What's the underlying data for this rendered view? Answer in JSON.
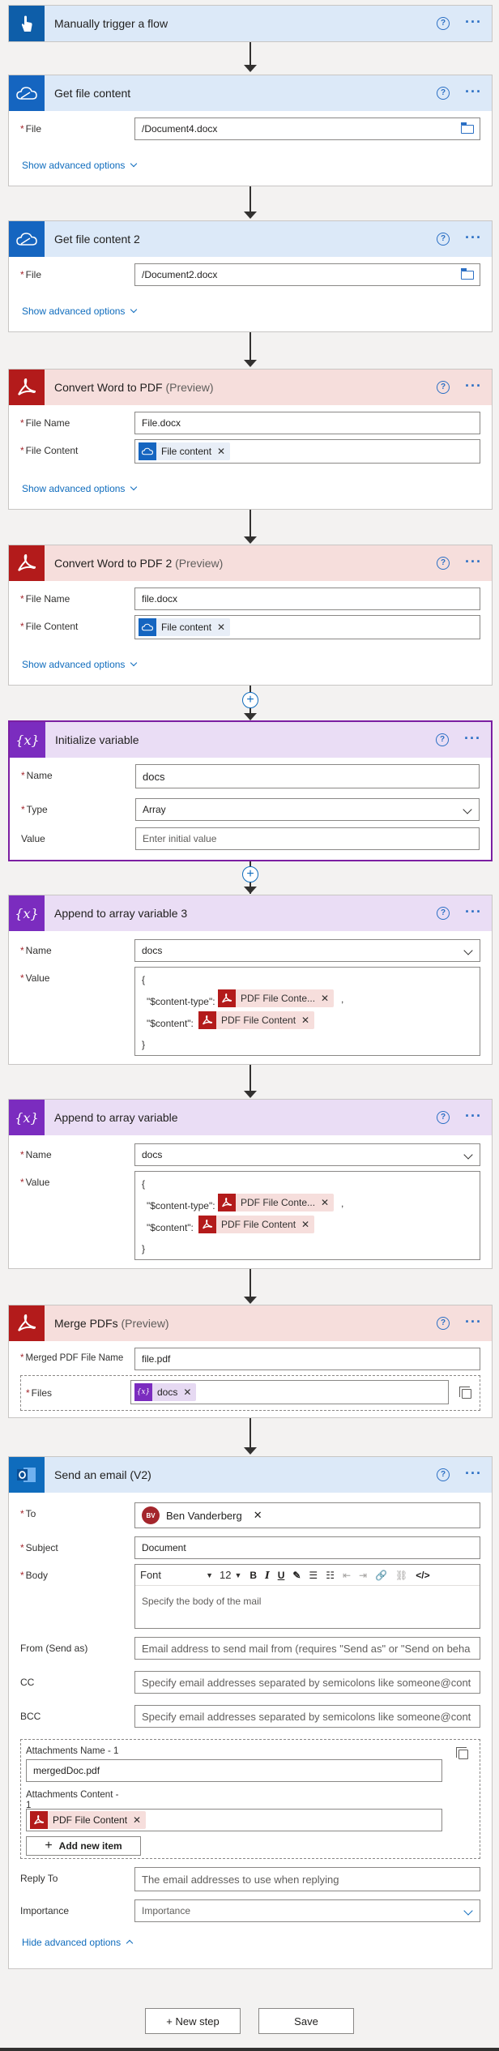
{
  "colors": {
    "blue_header": "#dce9f8",
    "red_header": "#f6dedc",
    "purple_header": "#eaddf5",
    "link": "#0f6cbd",
    "selected_border": "#7b1fa2"
  },
  "trigger": {
    "title": "Manually trigger a flow",
    "icon": "touch-icon"
  },
  "get_file_1": {
    "title": "Get file content",
    "file_label": "File",
    "file_value": "/Document4.docx",
    "advanced": "Show advanced options"
  },
  "get_file_2": {
    "title": "Get file content 2",
    "file_label": "File",
    "file_value": "/Document2.docx",
    "advanced": "Show advanced options"
  },
  "convert_1": {
    "title": "Convert Word to PDF",
    "preview": "(Preview)",
    "file_name_label": "File Name",
    "file_name_value": "File.docx",
    "file_content_label": "File Content",
    "file_content_token": "File content",
    "advanced": "Show advanced options"
  },
  "convert_2": {
    "title": "Convert Word to PDF 2",
    "preview": "(Preview)",
    "file_name_label": "File Name",
    "file_name_value": "file.docx",
    "file_content_label": "File Content",
    "file_content_token": "File content",
    "advanced": "Show advanced options"
  },
  "init_var": {
    "title": "Initialize variable",
    "name_label": "Name",
    "name_value": "docs",
    "type_label": "Type",
    "type_value": "Array",
    "value_label": "Value",
    "value_placeholder": "Enter initial value"
  },
  "append_3": {
    "title": "Append to array variable 3",
    "name_label": "Name",
    "name_value": "docs",
    "value_label": "Value",
    "open_brace": "{",
    "close_brace": "}",
    "key_content_type": "\"$content-type\":",
    "key_content": "\"$content\":",
    "token_content_type": "PDF File Conte...",
    "token_content": "PDF File Content",
    "comma": ","
  },
  "append": {
    "title": "Append to array variable",
    "name_label": "Name",
    "name_value": "docs",
    "value_label": "Value",
    "open_brace": "{",
    "close_brace": "}",
    "key_content_type": "\"$content-type\":",
    "key_content": "\"$content\":",
    "token_content_type": "PDF File Conte...",
    "token_content": "PDF File Content",
    "comma": ","
  },
  "merge": {
    "title": "Merge PDFs",
    "preview": "(Preview)",
    "merged_label": "Merged PDF File Name",
    "merged_value": "file.pdf",
    "files_label": "Files",
    "files_token": "docs"
  },
  "email": {
    "title": "Send an email (V2)",
    "to_label": "To",
    "to_initials": "BV",
    "to_name": "Ben Vanderberg",
    "subject_label": "Subject",
    "subject_value": "Document",
    "body_label": "Body",
    "font": "Font",
    "font_size": "12",
    "body_placeholder": "Specify the body of the mail",
    "from_label": "From (Send as)",
    "from_placeholder": "Email address to send mail from (requires \"Send as\" or \"Send on beha",
    "cc_label": "CC",
    "cc_placeholder": "Specify email addresses separated by semicolons like someone@cont",
    "bcc_label": "BCC",
    "bcc_placeholder": "Specify email addresses separated by semicolons like someone@cont",
    "att_name_label": "Attachments Name - 1",
    "att_name_value": "mergedDoc.pdf",
    "att_content_label": "Attachments Content -",
    "att_content_index": "1",
    "att_content_token": "PDF File Content",
    "add_item": "Add new item",
    "reply_label": "Reply To",
    "reply_placeholder": "The email addresses to use when replying",
    "importance_label": "Importance",
    "importance_placeholder": "Importance",
    "hide_advanced": "Hide advanced options"
  },
  "footer": {
    "new_step": "+ New step",
    "save": "Save"
  }
}
